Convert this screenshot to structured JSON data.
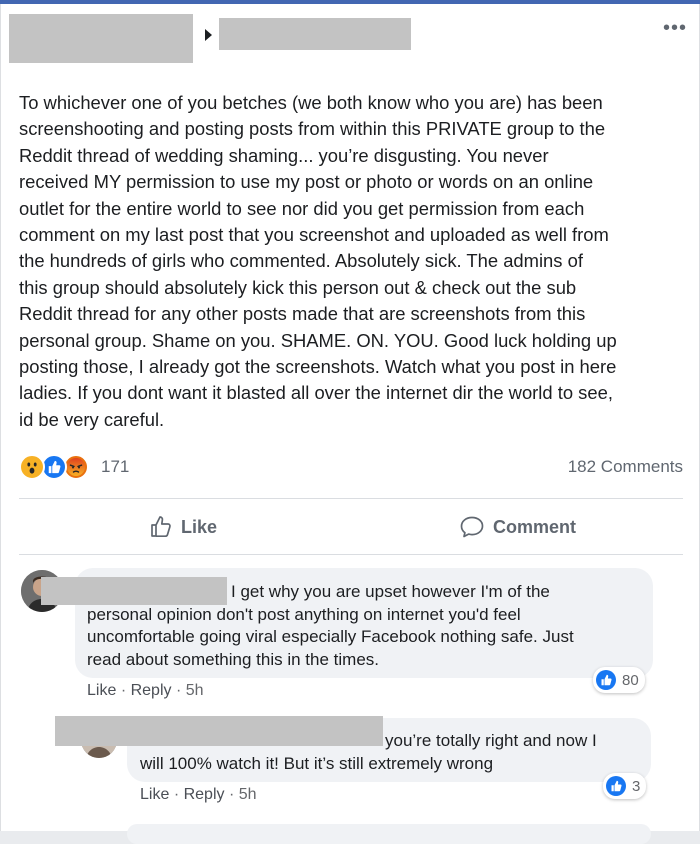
{
  "header": {
    "more_glyph": "•••"
  },
  "post": {
    "text": "To whichever one of you betches (we both know who you are) has been\nscreenshooting and posting posts from within this PRIVATE group to the\nReddit thread of wedding shaming... you’re disgusting. You never\nreceived MY permission to use my post or photo or words on an online\noutlet for the entire world to see nor did you get permission from each\ncomment on my last post that you screenshot and uploaded as well from\nthe hundreds of girls who commented. Absolutely sick. The admins of\nthis group should absolutely kick this person out & check out the sub\nReddit thread for any other posts made that are screenshots from this\npersonal group. Shame on you. SHAME. ON. YOU. Good luck holding up\nposting those, I already got the screenshots. Watch what you post in here\nladies. If you dont want it blasted all over the internet dir the world to see,\nid be very careful.",
    "reaction_icons": [
      "wow-icon",
      "like-icon",
      "angry-icon"
    ],
    "reaction_count": "171",
    "comments_count": "182 Comments"
  },
  "actions": {
    "like_label": "Like",
    "comment_label": "Comment"
  },
  "comments": [
    {
      "text": "I get why you are upset however I'm of the\npersonal opinion don't post anything on internet you'd feel\nuncomfortable going viral especially Facebook nothing safe. Just\nread about something this in the times.",
      "like_label": "Like",
      "reply_label": "Reply",
      "time": "5h",
      "reactions": "80"
    },
    {
      "text": "you’re totally right and now I\nwill 100% watch it! But it’s still extremely wrong",
      "like_label": "Like",
      "reply_label": "Reply",
      "time": "5h",
      "reactions": "3"
    }
  ],
  "colors": {
    "accent": "#1877f2",
    "text": "#1c1e21",
    "muted": "#606770",
    "bubble": "#f0f2f5",
    "redaction": "#c3c3c3"
  }
}
